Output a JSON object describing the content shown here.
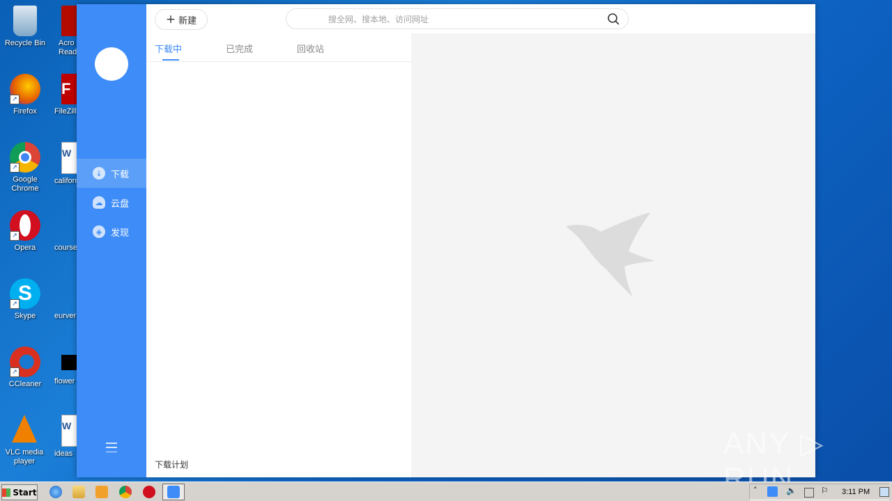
{
  "desktop": {
    "icons_col1": [
      {
        "label": "Recycle Bin",
        "icon": "recycle-bin-icon",
        "color": "#7fa8c8"
      },
      {
        "label": "Firefox",
        "icon": "firefox-icon",
        "color": "#e66000"
      },
      {
        "label": "Google Chrome",
        "icon": "chrome-icon",
        "color": "#3aa757"
      },
      {
        "label": "Opera",
        "icon": "opera-icon",
        "color": "#d10f1f"
      },
      {
        "label": "Skype",
        "icon": "skype-icon",
        "color": "#00aff0"
      },
      {
        "label": "CCleaner",
        "icon": "ccleaner-icon",
        "color": "#d9301f"
      },
      {
        "label": "VLC media player",
        "icon": "vlc-icon",
        "color": "#f08000"
      }
    ],
    "icons_col2": [
      {
        "label": "Acro Read",
        "icon": "acrobat-icon",
        "color": "#b30b00"
      },
      {
        "label": "FileZilla",
        "icon": "filezilla-icon",
        "color": "#bf0000"
      },
      {
        "label": "californ",
        "icon": "word-doc-icon",
        "color": "#2b579a"
      },
      {
        "label": "courseo",
        "icon": "document-icon",
        "color": "#1c66c0"
      },
      {
        "label": "eurver",
        "icon": "document-icon",
        "color": "#1c66c0"
      },
      {
        "label": "flower",
        "icon": "image-file-icon",
        "color": "#000000"
      },
      {
        "label": "ideas",
        "icon": "word-doc-icon",
        "color": "#2b579a"
      }
    ]
  },
  "app": {
    "new_button": "新建",
    "search_placeholder": "搜全网、搜本地、访问网址",
    "nav": [
      {
        "label": "下载",
        "icon": "download-icon"
      },
      {
        "label": "云盘",
        "icon": "cloud-icon"
      },
      {
        "label": "发现",
        "icon": "compass-icon"
      }
    ],
    "tabs": [
      "下载中",
      "已完成",
      "回收站"
    ],
    "footer_link": "下载计划",
    "accent": "#3d8cf7"
  },
  "watermark": "ANY ▷ RUN",
  "taskbar": {
    "start_label": "Start",
    "clock": "3:11 PM"
  }
}
